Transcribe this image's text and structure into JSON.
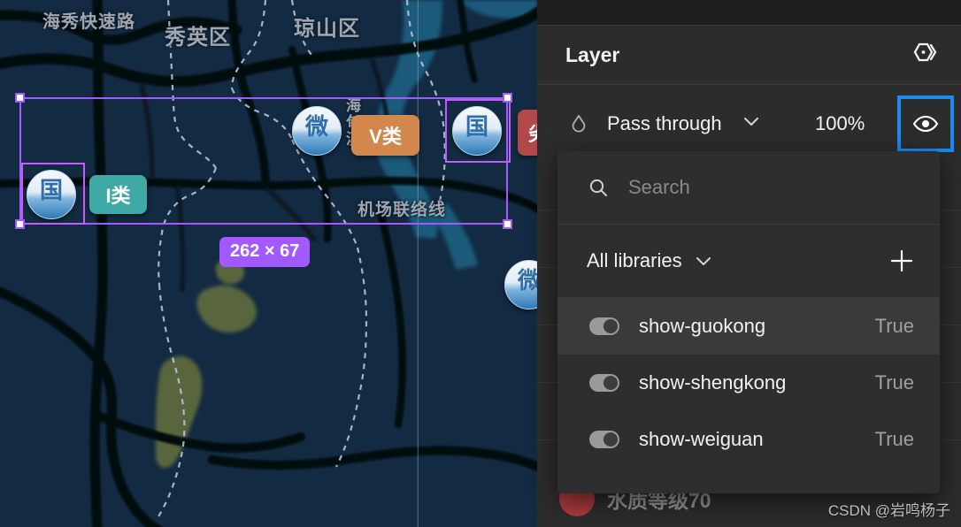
{
  "panel": {
    "title": "Layer",
    "component_icon": "component-hexagon-icon",
    "blend": {
      "opacity_icon": "droplet-icon",
      "mode": "Pass through",
      "chevron": "chevron-down-icon",
      "opacity": "100%",
      "visibility_icon": "eye-icon",
      "accent_color": "#1a8cf0"
    },
    "hidden_layer_label": "水质等级70"
  },
  "dropdown": {
    "search": {
      "icon": "search-icon",
      "value": "",
      "placeholder": "Search"
    },
    "libraries": {
      "label": "All libraries",
      "chevron": "chevron-down-icon",
      "add_icon": "plus-icon"
    },
    "properties": [
      {
        "name": "show-guokong",
        "value": "True",
        "toggle": "on",
        "selected": true
      },
      {
        "name": "show-shengkong",
        "value": "True",
        "toggle": "on",
        "selected": false
      },
      {
        "name": "show-weiguan",
        "value": "True",
        "toggle": "on",
        "selected": false
      }
    ]
  },
  "map": {
    "labels": [
      {
        "text": "海秀快速路",
        "size": 20
      },
      {
        "text": "秀英区",
        "size": 24
      },
      {
        "text": "琼山区",
        "size": 24
      },
      {
        "text": "机场联络线",
        "size": 19
      },
      {
        "text": "海甸溪",
        "size": 17
      }
    ],
    "markers": [
      {
        "glyph": "国",
        "kind": "station-marker"
      },
      {
        "glyph": "微",
        "kind": "station-marker"
      },
      {
        "glyph": "国",
        "kind": "station-marker"
      },
      {
        "glyph": "微",
        "kind": "station-marker"
      }
    ],
    "badges": [
      {
        "text": "I类",
        "color": "#3fa9a6"
      },
      {
        "text": "V类",
        "color": "#d2884c"
      },
      {
        "text": "劣",
        "color": "#b3484a"
      }
    ],
    "selection": {
      "dimension_label": "262 × 67",
      "handle_color": "#a259ff"
    }
  },
  "watermark": "CSDN @岩鸣杨子"
}
